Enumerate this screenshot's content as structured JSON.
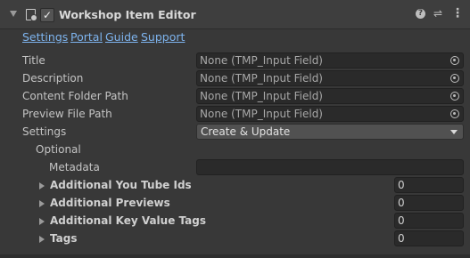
{
  "header": {
    "title": "Workshop Item Editor",
    "enabled_mark": "✓",
    "help_glyph": "?",
    "preset_glyph": "⇌",
    "menu_glyph": "⋮"
  },
  "links": [
    "Settings",
    "Portal",
    "Guide",
    "Support"
  ],
  "fields": [
    {
      "label": "Title",
      "value": "None (TMP_Input Field)"
    },
    {
      "label": "Description",
      "value": "None (TMP_Input Field)"
    },
    {
      "label": "Content Folder Path",
      "value": "None (TMP_Input Field)"
    },
    {
      "label": "Preview File Path",
      "value": "None (TMP_Input Field)"
    }
  ],
  "settings": {
    "label": "Settings",
    "value": "Create & Update"
  },
  "optional": {
    "label": "Optional"
  },
  "metadata": {
    "label": "Metadata",
    "value": ""
  },
  "arrays": [
    {
      "label": "Additional You Tube Ids",
      "count": "0"
    },
    {
      "label": "Additional Previews",
      "count": "0"
    },
    {
      "label": "Additional Key Value Tags",
      "count": "0"
    },
    {
      "label": "Tags",
      "count": "0"
    }
  ],
  "colors": {
    "background": "#383838",
    "header": "#3e3e3e",
    "link": "#7eb4ee",
    "field": "#2a2a2a",
    "dropdown": "#515151"
  }
}
